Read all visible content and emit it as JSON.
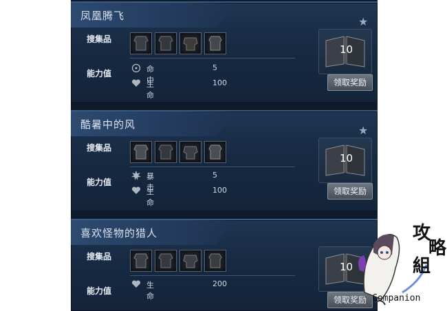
{
  "achievements": [
    {
      "title": "凤凰腾飞",
      "collect_label": "搜集品",
      "stat_label": "能力值",
      "stats": [
        {
          "icon": "crosshair-icon",
          "name": "命中",
          "value": "5"
        },
        {
          "icon": "heart-icon",
          "name": "生命",
          "value": "100"
        }
      ],
      "reward_count": "10",
      "claim_label": "领取奖励"
    },
    {
      "title": "酷暑中的风",
      "collect_label": "搜集品",
      "stat_label": "能力值",
      "stats": [
        {
          "icon": "burst-icon",
          "name": "暴击",
          "value": "5"
        },
        {
          "icon": "heart-icon",
          "name": "生命",
          "value": "100"
        }
      ],
      "reward_count": "10",
      "claim_label": "领取奖励"
    },
    {
      "title": "喜欢怪物的猎人",
      "collect_label": "搜集品",
      "stat_label": "能力值",
      "stats": [
        {
          "icon": "heart-icon",
          "name": "生命",
          "value": "200"
        }
      ],
      "reward_count": "10",
      "claim_label": "领取奖励"
    }
  ],
  "watermark": {
    "chars": [
      "攻",
      "略",
      "組"
    ],
    "text": "Companion"
  }
}
